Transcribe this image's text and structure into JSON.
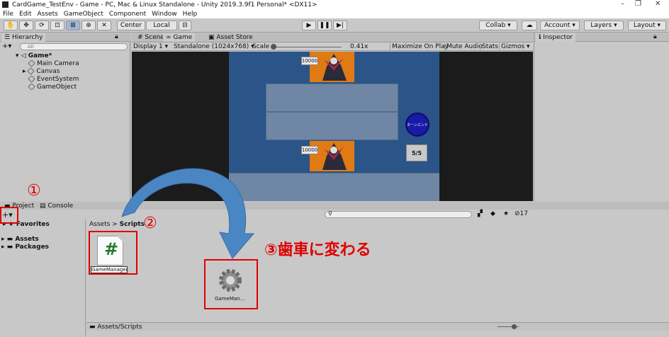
{
  "window": {
    "title": "CardGame_TestEnv - Game - PC, Mac & Linux Standalone - Unity 2019.3.9f1 Personal* <DX11>",
    "minimize": "–",
    "maximize": "❐",
    "close": "✕"
  },
  "menu": [
    "File",
    "Edit",
    "Assets",
    "GameObject",
    "Component",
    "Window",
    "Help"
  ],
  "toolbar": {
    "center": "Center",
    "local": "Local",
    "collab": "Collab ▾",
    "account": "Account",
    "layers": "Layers",
    "layout": "Layout"
  },
  "hierarchy": {
    "tab": "Hierarchy",
    "search_placeholder": "All",
    "scene": "Game*",
    "items": [
      "Main Camera",
      "Canvas",
      "EventSystem",
      "GameObject"
    ]
  },
  "center_tabs": [
    "Scene",
    "Game",
    "Asset Store"
  ],
  "game_bar": {
    "display": "Display 1",
    "resolution": "Standalone (1024x768)",
    "scale_label": "Scale",
    "scale_value": "0.41x",
    "maximize": "Maximize On Play",
    "mute": "Mute Audio",
    "stats": "Stats",
    "gizmos": "Gizmos"
  },
  "inspector": {
    "tab": "Inspector"
  },
  "game": {
    "enemy_hp": "10000",
    "player_hp": "10000",
    "turn_end": "ターンエンド",
    "mana": "5/5"
  },
  "project": {
    "tab_project": "Project",
    "tab_console": "Console",
    "create_button": "+▾",
    "favorites": "Favorites",
    "tree": [
      "Assets",
      "Packages"
    ],
    "breadcrumb_root": "Assets",
    "breadcrumb_sep": ">",
    "breadcrumb_current": "Scripts",
    "asset_new_name": "GameManager",
    "asset_icon_glyph": "#",
    "asset_converted_name": "GameMan...",
    "footer_path": "Assets/Scripts",
    "count": "17"
  },
  "annotations": {
    "step1": "①",
    "step2": "②",
    "step3": "③歯車に変わる"
  },
  "colors": {
    "annotation_red": "#e00000",
    "game_bg": "#2b5488",
    "card_orange": "#e07a14",
    "turn_button": "#1a1aa8",
    "arrow": "#4a86c4"
  }
}
